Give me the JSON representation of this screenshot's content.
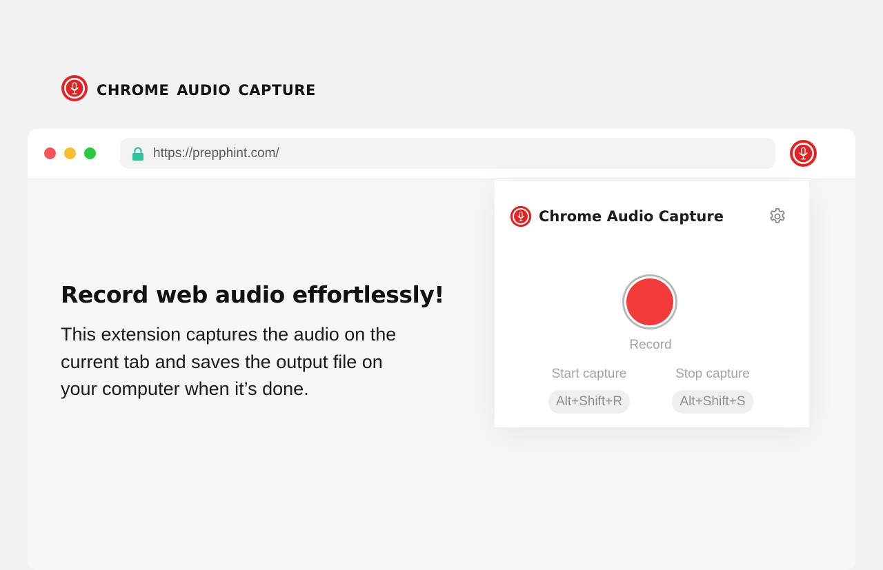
{
  "brand": {
    "title": "CHROME AUDIO CAPTURE",
    "logo_icon": "microphone-logo-icon",
    "accent_color": "#e02424"
  },
  "browser": {
    "url": "https://prepphint.com/",
    "lock_icon": "lock-icon",
    "lock_color": "#34c39a",
    "extension_icon": "microphone-logo-icon",
    "window_controls": {
      "close_color": "#f2555a",
      "minimize_color": "#f7bd2e",
      "maximize_color": "#2ac840"
    }
  },
  "hero": {
    "headline": "Record web audio effortlessly!",
    "description": "This extension captures the audio on the current tab and saves the output file on your computer when it’s done."
  },
  "popup": {
    "title": "Chrome Audio Capture",
    "settings_icon": "gear-icon",
    "record_label": "Record",
    "record_color": "#f43b3b",
    "start_capture_label": "Start capture",
    "start_capture_shortcut": "Alt+Shift+R",
    "stop_capture_label": "Stop capture",
    "stop_capture_shortcut": "Alt+Shift+S"
  }
}
